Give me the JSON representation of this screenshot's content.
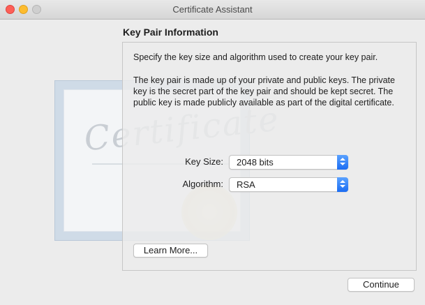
{
  "window": {
    "title": "Certificate Assistant"
  },
  "decoration": {
    "certificate_word": "Certificate"
  },
  "section": {
    "title": "Key Pair Information"
  },
  "content": {
    "intro": "Specify the key size and algorithm used to create your key pair.",
    "description": "The key pair is made up of your private and public keys. The private key is the secret part of the key pair and should be kept secret. The public key is made publicly available as part of the digital certificate."
  },
  "fields": {
    "key_size": {
      "label": "Key Size:",
      "value": "2048 bits"
    },
    "algorithm": {
      "label": "Algorithm:",
      "value": "RSA"
    }
  },
  "buttons": {
    "learn_more": "Learn More...",
    "continue": "Continue"
  },
  "colors": {
    "accent": "#1b6cf2",
    "close": "#fd5f57",
    "minimize": "#fdbc2e",
    "zoom_disabled": "#cfcfcf"
  }
}
